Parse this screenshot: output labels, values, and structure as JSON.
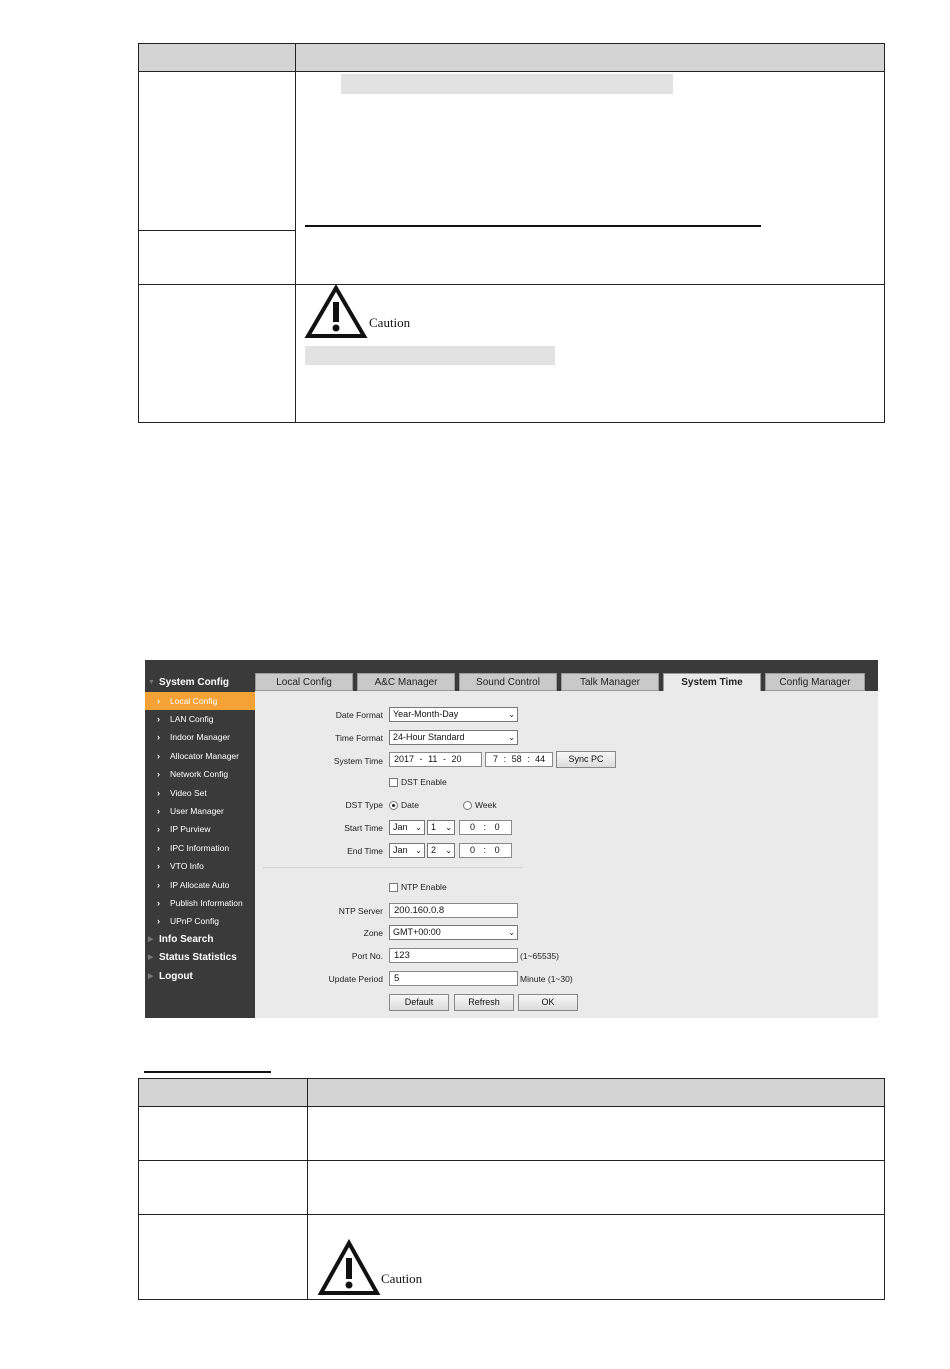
{
  "caution_label": "Caution",
  "app": {
    "sidebar": {
      "groups": [
        {
          "label": "System Config"
        },
        {
          "label": "Info Search"
        },
        {
          "label": "Status Statistics"
        },
        {
          "label": "Logout"
        }
      ],
      "items": [
        {
          "label": "Local Config",
          "active": true
        },
        {
          "label": "LAN Config"
        },
        {
          "label": "Indoor Manager"
        },
        {
          "label": "Allocator Manager"
        },
        {
          "label": "Network Config"
        },
        {
          "label": "Video Set"
        },
        {
          "label": "User Manager"
        },
        {
          "label": "IP Purview"
        },
        {
          "label": "IPC Information"
        },
        {
          "label": "VTO Info"
        },
        {
          "label": "IP Allocate Auto"
        },
        {
          "label": "Publish Information"
        },
        {
          "label": "UPnP Config"
        }
      ]
    },
    "tabs": [
      {
        "label": "Local Config"
      },
      {
        "label": "A&C Manager"
      },
      {
        "label": "Sound Control"
      },
      {
        "label": "Talk Manager"
      },
      {
        "label": "System Time",
        "active": true
      },
      {
        "label": "Config Manager"
      }
    ],
    "form": {
      "date_format_label": "Date Format",
      "date_format_value": "Year-Month-Day",
      "time_format_label": "Time Format",
      "time_format_value": "24-Hour Standard",
      "system_time_label": "System Time",
      "date_year": "2017",
      "date_month": "11",
      "date_day": "20",
      "date_sep": "-",
      "time_hour": "7",
      "time_min": "58",
      "time_sec": "44",
      "time_sep": ":",
      "sync_pc": "Sync PC",
      "dst_enable": "DST Enable",
      "dst_type_label": "DST Type",
      "dst_type_date": "Date",
      "dst_type_week": "Week",
      "start_time_label": "Start Time",
      "start_month": "Jan",
      "start_day": "1",
      "start_hour": "0",
      "start_min": "0",
      "end_time_label": "End Time",
      "end_month": "Jan",
      "end_day": "2",
      "end_hour": "0",
      "end_min": "0",
      "ntp_enable": "NTP Enable",
      "ntp_server_label": "NTP Server",
      "ntp_server_value": "200.160.0.8",
      "zone_label": "Zone",
      "zone_value": "GMT+00:00",
      "port_label": "Port No.",
      "port_value": "123",
      "port_hint": "(1~65535)",
      "update_label": "Update Period",
      "update_value": "5",
      "update_hint": "Minute (1~30)",
      "btn_default": "Default",
      "btn_refresh": "Refresh",
      "btn_ok": "OK"
    }
  }
}
